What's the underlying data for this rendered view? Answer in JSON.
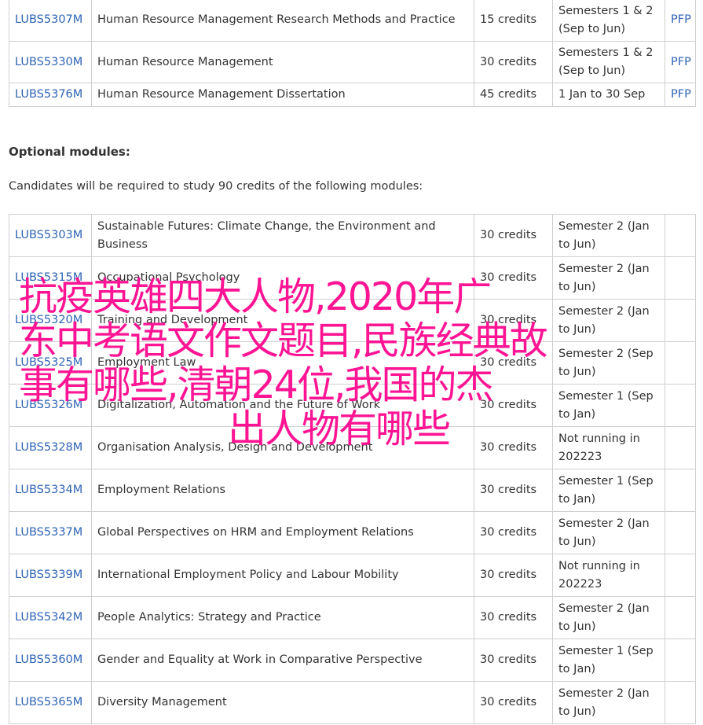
{
  "core_modules": [
    {
      "code": "LUBS5307M",
      "title": "Human Resource Management Research Methods and Practice",
      "credits": "15 credits",
      "semester": "Semesters 1 & 2 (Sep to Jun)",
      "pfp": "PFP"
    },
    {
      "code": "LUBS5330M",
      "title": "Human Resource Management",
      "credits": "30 credits",
      "semester": "Semesters 1 & 2 (Sep to Jun)",
      "pfp": "PFP"
    },
    {
      "code": "LUBS5376M",
      "title": "Human Resource Management Dissertation",
      "credits": "45 credits",
      "semester": "1 Jan to 30 Sep",
      "pfp": "PFP"
    }
  ],
  "optional_heading": "Optional modules:",
  "optional_intro": "Candidates will be required to study 90 credits of the following modules:",
  "optional_modules": [
    {
      "code": "LUBS5303M",
      "title": "Sustainable Futures: Climate Change, the Environment and Business",
      "credits": "30 credits",
      "semester": "Semester 2 (Jan to Jun)"
    },
    {
      "code": "LUBS5315M",
      "title": "Occupational Psychology",
      "credits": "30 credits",
      "semester": "Semester 2 (Jan to Jun)"
    },
    {
      "code": "LUBS5320M",
      "title": "Training and Development",
      "credits": "30 credits",
      "semester": "Semester 2 (Jan to Jun)"
    },
    {
      "code": "LUBS5325M",
      "title": "Employment Law",
      "credits": "30 credits",
      "semester": "Semester 2 (Sep to Jun)"
    },
    {
      "code": "LUBS5326M",
      "title": "Digitalization, Automation and the Future of Work",
      "credits": "30 credits",
      "semester": "Semester 1 (Sep to Jan)"
    },
    {
      "code": "LUBS5328M",
      "title": "Organisation Analysis, Design and Development",
      "credits": "30 credits",
      "semester": "Not running in 202223"
    },
    {
      "code": "LUBS5334M",
      "title": "Employment Relations",
      "credits": "30 credits",
      "semester": "Semester 1 (Sep to Jan)"
    },
    {
      "code": "LUBS5337M",
      "title": "Global Perspectives on HRM and Employment Relations",
      "credits": "30 credits",
      "semester": "Semester 2 (Jan to Jun)"
    },
    {
      "code": "LUBS5339M",
      "title": "International Employment Policy and Labour Mobility",
      "credits": "30 credits",
      "semester": "Not running in 202223"
    },
    {
      "code": "LUBS5342M",
      "title": "People Analytics: Strategy and Practice",
      "credits": "30 credits",
      "semester": "Semester 2 (Jan to Jun)"
    },
    {
      "code": "LUBS5360M",
      "title": "Gender and Equality at Work in Comparative Perspective",
      "credits": "30 credits",
      "semester": "Semester 1 (Sep to Jan)"
    },
    {
      "code": "LUBS5365M",
      "title": "Diversity Management",
      "credits": "30 credits",
      "semester": "Semester 2 (Jan to Jun)"
    }
  ],
  "overlay": {
    "line1": "抗疫英雄四大人物,2020年广",
    "line2": "东中考语文作文题目,民族经典故",
    "line3": "事有哪些,清朝24位,我国的杰",
    "line4": "出人物有哪些",
    "color": "#ff1493"
  },
  "colors": {
    "link": "#2f64b5",
    "border": "#cfcfcf",
    "text": "#333333"
  }
}
